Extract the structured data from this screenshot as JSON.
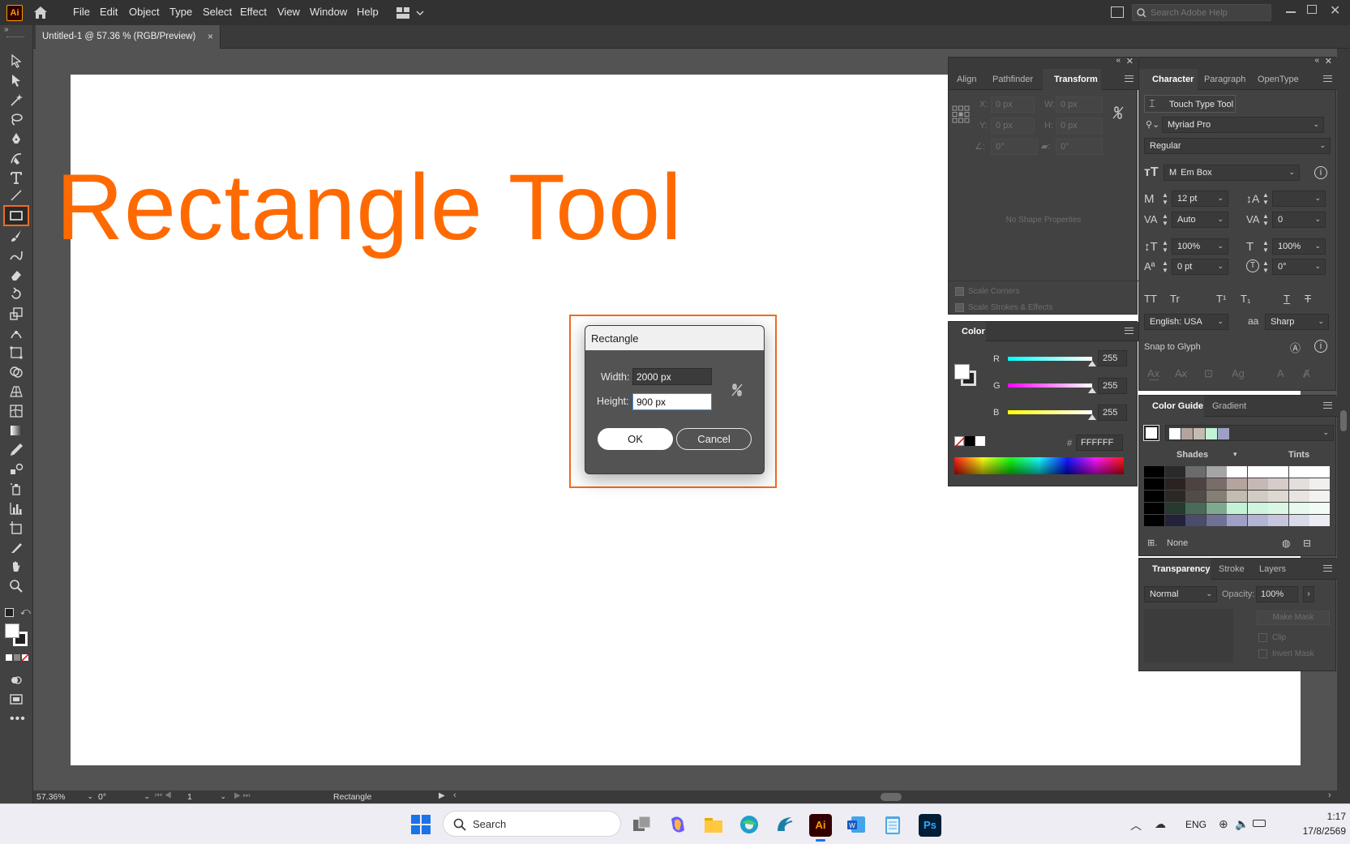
{
  "app": {
    "logo": "Ai"
  },
  "menu": [
    "File",
    "Edit",
    "Object",
    "Type",
    "Select",
    "Effect",
    "View",
    "Window",
    "Help"
  ],
  "help_search": {
    "placeholder": "Search Adobe Help"
  },
  "document_tab": {
    "title": "Untitled-1 @ 57.36 % (RGB/Preview)",
    "close": "×"
  },
  "canvas": {
    "headline": "Rectangle Tool",
    "artboard_color": "#ffffff",
    "headline_color": "#ff6a00"
  },
  "dialog": {
    "title": "Rectangle",
    "width_label": "Width:",
    "width_value": "2000 px",
    "height_label": "Height:",
    "height_value": "900 px",
    "ok": "OK",
    "cancel": "Cancel",
    "highlight_color": "#f26b21"
  },
  "transform_panel": {
    "tabs": [
      "Align",
      "Pathfinder",
      "Transform"
    ],
    "x_label": "X:",
    "x_value": "0 px",
    "y_label": "Y:",
    "y_value": "0 px",
    "w_label": "W:",
    "w_value": "0 px",
    "h_label": "H:",
    "h_value": "0 px",
    "angle_value": "0°",
    "shear_value": "0°",
    "empty_note": "No Shape Properties",
    "scale_corners": "Scale Corners",
    "scale_strokes": "Scale Strokes & Effects"
  },
  "color_panel": {
    "title": "Color",
    "r_label": "R",
    "r_value": "255",
    "g_label": "G",
    "g_value": "255",
    "b_label": "B",
    "b_value": "255",
    "hex_label": "#",
    "hex_value": "FFFFFF"
  },
  "character_panel": {
    "tabs": [
      "Character",
      "Paragraph",
      "OpenType"
    ],
    "touch_type": "Touch Type Tool",
    "font_family": "Myriad Pro",
    "font_style": "Regular",
    "em_box": "Em Box",
    "size": "12 pt",
    "leading": "",
    "kerning": "Auto",
    "tracking": "0",
    "v_scale": "100%",
    "h_scale": "100%",
    "baseline": "0 pt",
    "rotation": "0°",
    "caps_buttons": [
      "TT",
      "Tr",
      "T¹",
      "T₁",
      "T",
      "T"
    ],
    "language": "English: USA",
    "aa_label": "aa",
    "antialias": "Sharp",
    "snap_to_glyph": "Snap to Glyph"
  },
  "color_guide_panel": {
    "tabs": [
      "Color Guide",
      "Gradient"
    ],
    "shades": "Shades",
    "tints": "Tints",
    "none_label": "None"
  },
  "transparency_panel": {
    "tabs": [
      "Transparency",
      "Stroke",
      "Layers"
    ],
    "blend_mode": "Normal",
    "opacity_label": "Opacity:",
    "opacity_value": "100%",
    "make_mask": "Make Mask",
    "clip": "Clip",
    "invert_mask": "Invert Mask"
  },
  "status_bar": {
    "zoom": "57.36%",
    "rotation": "0°",
    "artboard": "1",
    "tool": "Rectangle"
  },
  "taskbar": {
    "search": "Search",
    "language": "ENG",
    "time": "1:17",
    "date": "17/8/2569"
  }
}
